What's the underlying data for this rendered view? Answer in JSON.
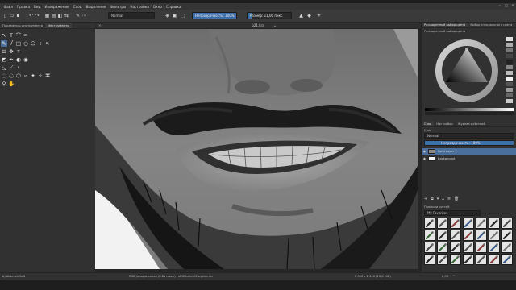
{
  "menubar": {
    "items": [
      "Файл",
      "Правка",
      "Вид",
      "Изображение",
      "Слой",
      "Выделение",
      "Фильтры",
      "Настройка",
      "Окно",
      "Справка"
    ]
  },
  "toolbar": {
    "blend_mode": "Normal",
    "opacity_label": "Непрозрачность: 100%",
    "opacity_fraction": 1.0,
    "size_label": "Размер: 11,00 пикс.",
    "size_fraction": 0.12
  },
  "left_panel": {
    "tabs": [
      "Параметры инструмента",
      "Инструменты"
    ]
  },
  "document": {
    "title": "p21.kra",
    "modified_mark": "*"
  },
  "right_panel": {
    "color_tabs": [
      "Расширенный выбор цвета",
      "Выбор специального цвета"
    ],
    "color_section_label": "Расширенный выбор цвета",
    "layer_tabs": [
      "Слои",
      "Настройки",
      "Журнал действий"
    ],
    "filter_label": "Слои",
    "blend_mode": "Normal",
    "opacity_label": "Непрозрачность: 100%",
    "layers": [
      {
        "name": "Paint Layer 1",
        "active": true
      },
      {
        "name": "Background",
        "active": false
      }
    ],
    "brush_section_label": "Профили кистей",
    "brush_tag": "My Favorites"
  },
  "statusbar": {
    "brush_name": "b) Airbrush Soft",
    "color_profile": "RGB (альфа-канал (8-битовое) - sRGB-elle-V2-srgbtrc.icc",
    "dimensions": "2 000 x 2 000 (15,6 MiB)",
    "zoom": "6,00",
    "zoom_unit": "°"
  },
  "colors": {
    "accent": "#3f6fa8",
    "selection": "#4a6f9c",
    "panel": "#313131"
  }
}
